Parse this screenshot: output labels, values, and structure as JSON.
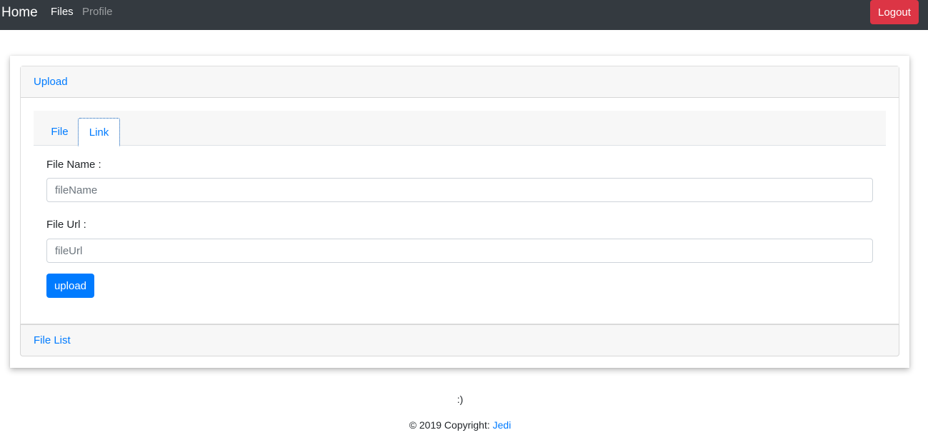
{
  "navbar": {
    "brand": "Home",
    "items": [
      {
        "label": "Files",
        "active": true
      },
      {
        "label": "Profile",
        "active": false
      }
    ],
    "logout_label": "Logout"
  },
  "accordion": {
    "upload_title": "Upload",
    "file_list_title": "File List"
  },
  "tabs": [
    {
      "label": "File",
      "active": false
    },
    {
      "label": "Link",
      "active": true
    }
  ],
  "form": {
    "file_name_label": "File Name :",
    "file_name_placeholder": "fileName",
    "file_url_label": "File Url :",
    "file_url_placeholder": "fileUrl",
    "upload_label": "upload"
  },
  "footer": {
    "smiley": ":)",
    "copyright_prefix": "© 2019 Copyright: ",
    "copyright_link": "Jedi"
  },
  "colors": {
    "navbar_bg": "#343a40",
    "accent": "#007bff",
    "danger": "#dc3545"
  }
}
